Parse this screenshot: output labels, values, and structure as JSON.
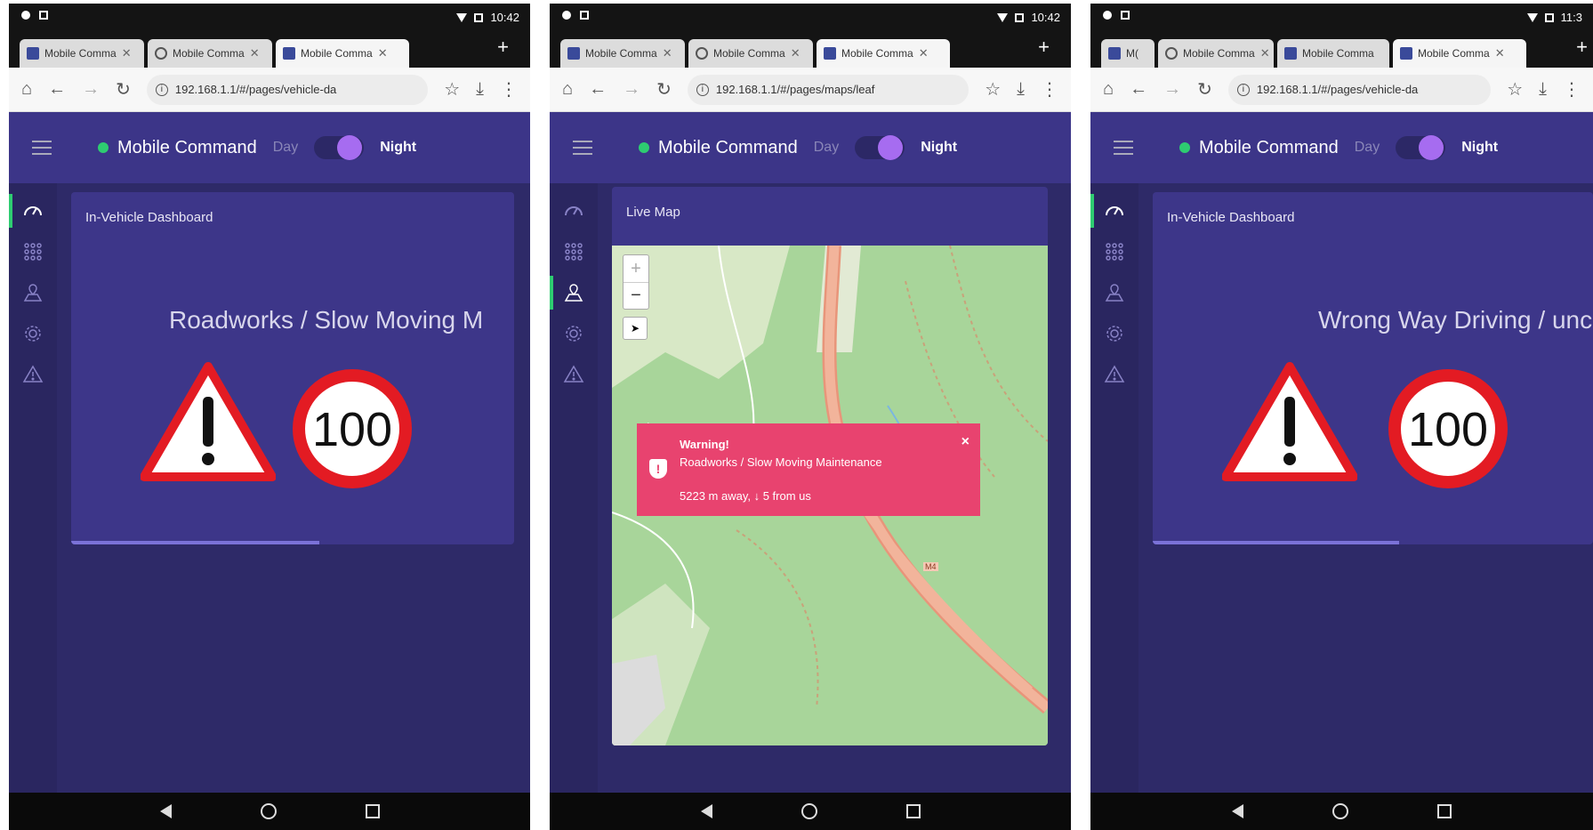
{
  "status": {
    "time_1": "10:42",
    "time_2": "10:42",
    "time_3": "11:3"
  },
  "tabs_1": [
    {
      "label": "Mobile Comma",
      "icon": "app-favicon"
    },
    {
      "label": "Mobile Comma",
      "icon": "globe-favicon"
    },
    {
      "label": "Mobile Comma",
      "icon": "app-favicon"
    }
  ],
  "tabs_2": [
    {
      "label": "Mobile Comma",
      "icon": "app-favicon"
    },
    {
      "label": "Mobile Comma",
      "icon": "globe-favicon"
    },
    {
      "label": "Mobile Comma",
      "icon": "app-favicon"
    }
  ],
  "tabs_3": [
    {
      "label": "M(",
      "icon": "app-favicon"
    },
    {
      "label": "Mobile Comma",
      "icon": "globe-favicon"
    },
    {
      "label": "Mobile Comma",
      "icon": "app-favicon"
    },
    {
      "label": "Mobile Comma",
      "icon": "app-favicon"
    }
  ],
  "urls": {
    "url_1": "192.168.1.1/#/pages/vehicle-da",
    "url_2": "192.168.1.1/#/pages/maps/leaf",
    "url_3": "192.168.1.1/#/pages/vehicle-da"
  },
  "app": {
    "title": "Mobile Command",
    "day_label": "Day",
    "night_label": "Night",
    "theme": "Night",
    "accent_color": "#a66cf0",
    "online_color": "#2ecc71",
    "warning_color": "#e8436f"
  },
  "nav_icons": [
    "speedometer-icon",
    "grid-icon",
    "map-icon",
    "settings-gear-icon",
    "alert-triangle-icon"
  ],
  "panel_1": {
    "title": "In-Vehicle Dashboard",
    "message": "Roadworks / Slow Moving M",
    "speed_limit": "100",
    "progress": 0.55
  },
  "panel_2": {
    "title": "Live Map",
    "zoom_in": "+",
    "zoom_out": "−",
    "popup_title": "Warning!",
    "popup_message": "Roadworks / Slow Moving Maintenance",
    "popup_distance": "5223 m away, ↓ 5 from us",
    "road_label": "M4"
  },
  "panel_3": {
    "title": "In-Vehicle Dashboard",
    "message": "Wrong Way Driving / unc",
    "speed_limit": "100",
    "progress": 0.66
  }
}
